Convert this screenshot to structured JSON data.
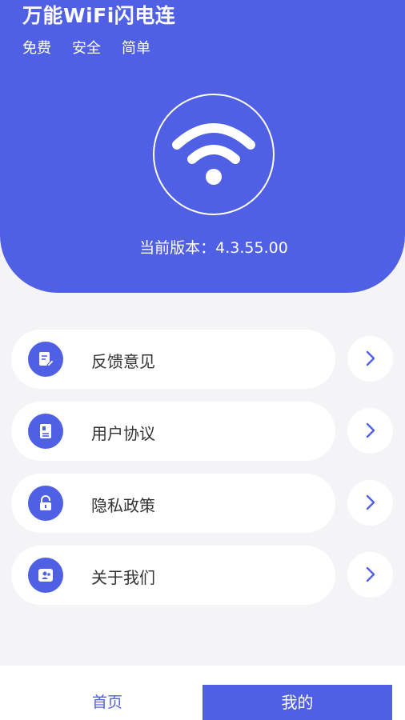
{
  "header": {
    "app_title": "万能WiFi闪电连",
    "tags": [
      "免费",
      "安全",
      "简单"
    ],
    "version": "当前版本：4.3.55.00"
  },
  "menu": [
    {
      "label": "反馈意见",
      "icon": "feedback-edit-icon"
    },
    {
      "label": "用户协议",
      "icon": "document-icon"
    },
    {
      "label": "隐私政策",
      "icon": "lock-icon"
    },
    {
      "label": "关于我们",
      "icon": "team-icon"
    }
  ],
  "tabbar": {
    "home": "首页",
    "mine": "我的"
  },
  "colors": {
    "accent": "#5060e4",
    "background": "#f4f4f6"
  }
}
